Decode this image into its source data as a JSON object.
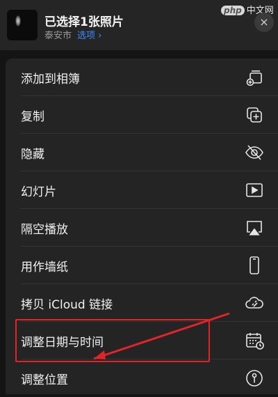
{
  "header": {
    "title": "已选择1张照片",
    "location": "泰安市",
    "select_link": "选项 ›",
    "close_icon": "×"
  },
  "watermark": {
    "badge": "php",
    "text": "中文网"
  },
  "menu": {
    "items": [
      {
        "label": "添加到相簿",
        "icon": "add-album-icon"
      },
      {
        "label": "复制",
        "icon": "duplicate-icon"
      },
      {
        "label": "隐藏",
        "icon": "eye-slash-icon"
      },
      {
        "label": "幻灯片",
        "icon": "play-rectangle-icon"
      },
      {
        "label": "隔空播放",
        "icon": "airplay-icon"
      },
      {
        "label": "用作墙纸",
        "icon": "iphone-icon"
      },
      {
        "label": "拷贝 iCloud 链接",
        "icon": "cloud-link-icon"
      },
      {
        "label": "调整日期与时间",
        "icon": "calendar-clock-icon"
      },
      {
        "label": "调整位置",
        "icon": "location-info-icon"
      }
    ]
  },
  "annotation": {
    "highlight_color": "#e0242b"
  }
}
